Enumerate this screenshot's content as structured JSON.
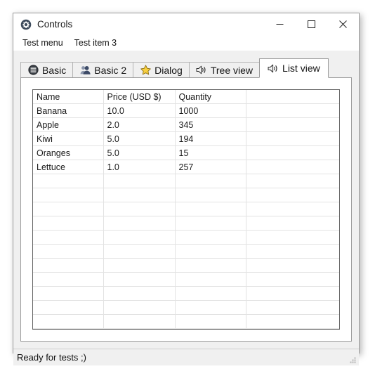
{
  "window": {
    "title": "Controls",
    "icon": "gear-icon",
    "buttons": {
      "minimize": "minimize-icon",
      "maximize": "maximize-icon",
      "close": "close-icon"
    }
  },
  "menubar": {
    "items": [
      {
        "label": "Test menu"
      },
      {
        "label": "Test item 3"
      }
    ]
  },
  "tabs": [
    {
      "label": "Basic",
      "icon": "list-circle-icon",
      "active": false
    },
    {
      "label": "Basic 2",
      "icon": "users-icon",
      "active": false
    },
    {
      "label": "Dialog",
      "icon": "star-icon",
      "active": false
    },
    {
      "label": "Tree view",
      "icon": "speaker-icon",
      "active": false
    },
    {
      "label": "List view",
      "icon": "speaker-icon",
      "active": true
    }
  ],
  "listview": {
    "columns": [
      "Name",
      "Price (USD $)",
      "Quantity",
      ""
    ],
    "rows": [
      [
        "Banana",
        "10.0",
        "1000",
        ""
      ],
      [
        "Apple",
        "2.0",
        "345",
        ""
      ],
      [
        "Kiwi",
        "5.0",
        "194",
        ""
      ],
      [
        "Oranges",
        "5.0",
        "15",
        ""
      ],
      [
        "Lettuce",
        "1.0",
        "257",
        ""
      ]
    ],
    "empty_row_count": 11
  },
  "statusbar": {
    "text": "Ready for tests ;)",
    "grip": "resize-grip-icon"
  },
  "colors": {
    "window_bg": "#f0f0f0",
    "panel_bg": "#ffffff",
    "border": "#9d9d9d",
    "grid_line": "#e3e3e3",
    "grid_border": "#646464",
    "star": "#f5c518",
    "close_hover": "#e81123"
  }
}
